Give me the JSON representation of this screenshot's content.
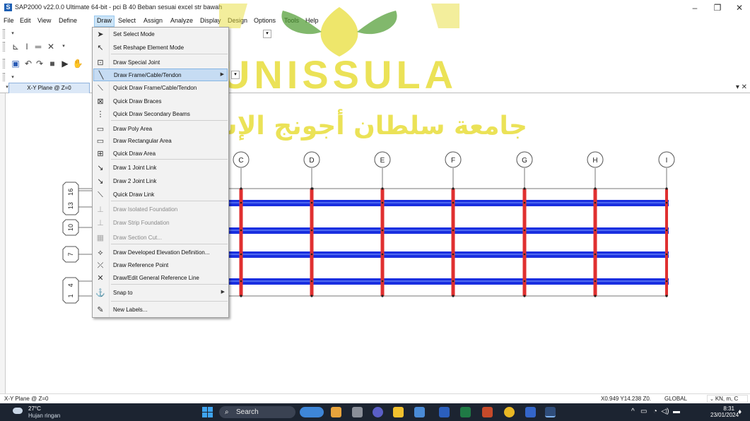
{
  "window": {
    "title": "SAP2000 v22.0.0 Ultimate 64-bit - pci B 40 Beban sesuai excel str bawah",
    "app_icon": "S",
    "minimize": "–",
    "maximize": "❐",
    "close": "✕"
  },
  "menu": [
    "File",
    "Edit",
    "View",
    "Define",
    "Draw",
    "Select",
    "Assign",
    "Analyze",
    "Display",
    "Design",
    "Options",
    "Tools",
    "Help"
  ],
  "active_menu": "Draw",
  "document": {
    "tab": "X-Y Plane @ Z=0",
    "close": "▾ ✕"
  },
  "draw_menu": {
    "items": [
      {
        "label": "Set Select Mode",
        "icon": "select-arrow-icon"
      },
      {
        "label": "Set Reshape Element Mode",
        "icon": "reshape-icon"
      },
      {
        "label": "Draw Special Joint",
        "icon": "special-joint-icon"
      },
      {
        "label": "Draw Frame/Cable/Tendon",
        "icon": "draw-frame-icon",
        "highlighted": true,
        "submenu": true
      },
      {
        "label": "Quick Draw Frame/Cable/Tendon",
        "icon": "quick-frame-icon"
      },
      {
        "label": "Quick Draw Braces",
        "icon": "braces-icon"
      },
      {
        "label": "Quick Draw Secondary Beams",
        "icon": "secondary-beams-icon"
      },
      {
        "label": "Draw Poly Area",
        "icon": "poly-area-icon"
      },
      {
        "label": "Draw Rectangular Area",
        "icon": "rect-area-icon"
      },
      {
        "label": "Quick Draw Area",
        "icon": "quick-area-icon"
      },
      {
        "label": "Draw 1 Joint Link",
        "icon": "one-joint-link-icon"
      },
      {
        "label": "Draw 2 Joint Link",
        "icon": "two-joint-link-icon"
      },
      {
        "label": "Quick Draw Link",
        "icon": "quick-link-icon"
      },
      {
        "label": "Draw Isolated Foundation",
        "icon": "isolated-foundation-icon",
        "disabled": true
      },
      {
        "label": "Draw Strip Foundation",
        "icon": "strip-foundation-icon",
        "disabled": true
      },
      {
        "label": "Draw Section Cut...",
        "icon": "section-cut-icon",
        "disabled": true
      },
      {
        "label": "Draw Developed Elevation Definition...",
        "icon": "developed-elevation-icon"
      },
      {
        "label": "Draw Reference Point",
        "icon": "reference-point-icon"
      },
      {
        "label": "Draw/Edit General Reference Line",
        "icon": "reference-line-icon"
      },
      {
        "label": "Snap to",
        "icon": "snap-icon",
        "submenu": true
      },
      {
        "label": "New Labels...",
        "icon": "new-labels-icon"
      }
    ]
  },
  "grid": {
    "columns": [
      "C",
      "D",
      "E",
      "F",
      "G",
      "H",
      "I"
    ],
    "rows": [
      "16",
      "13",
      "10",
      "7",
      "4",
      "1"
    ]
  },
  "watermark": {
    "latin": "UNISSULA",
    "arabic": "جامعة سلطان أجونج الإسلامية"
  },
  "status": {
    "left": "X-Y Plane @ Z=0",
    "coordinates": "X0.949  Y14.238  Z0.",
    "coord_system": "GLOBAL",
    "units": "KN, m, C"
  },
  "taskbar": {
    "temperature": "27°C",
    "weather": "Hujan ringan",
    "search_placeholder": "Search",
    "time": "8:31",
    "date": "23/01/2024"
  },
  "colors": {
    "beam_blue": "#1a2fe0",
    "column_red": "#e03030",
    "menu_highlight": "#c6dcf3",
    "watermark_gold": "#e8dd3a",
    "watermark_green": "#4c9a2e"
  }
}
